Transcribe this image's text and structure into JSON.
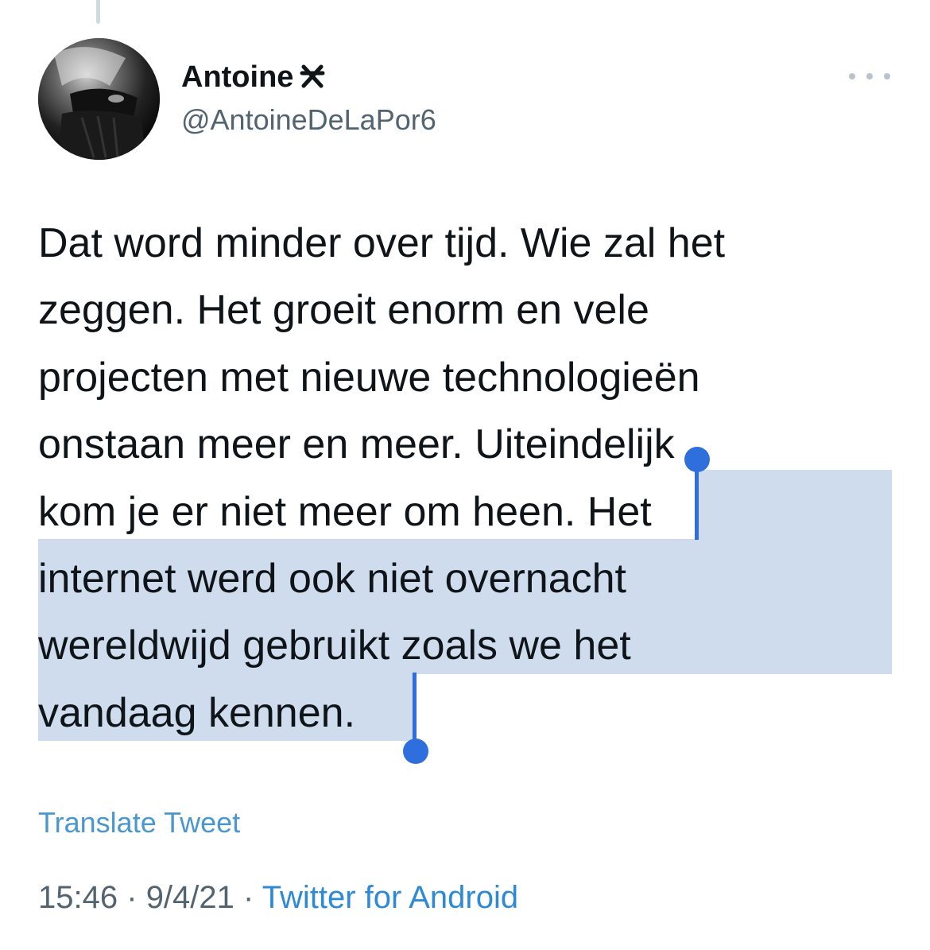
{
  "author": {
    "display_name": "Antoine",
    "badge_glyph": "✘",
    "handle": "@AntoineDeLaPor6"
  },
  "tweet": {
    "lines": [
      {
        "plain": "Dat word minder over tijd. Wie zal het",
        "selected": ""
      },
      {
        "plain": "zeggen. Het groeit enorm en vele",
        "selected": ""
      },
      {
        "plain": "projecten met nieuwe technologieën",
        "selected": ""
      },
      {
        "plain": "onstaan meer en meer. Uiteindelijk",
        "selected": ""
      },
      {
        "plain": "kom je er niet meer om heen. ",
        "selected": "Het"
      },
      {
        "plain": "",
        "selected": "internet werd ook niet overnacht"
      },
      {
        "plain": "",
        "selected": "wereldwijd gebruikt zoals we het"
      },
      {
        "plain": "",
        "selected": "vandaag kennen."
      }
    ]
  },
  "translate_label": "Translate Tweet",
  "meta": {
    "time": "15:46",
    "separator": "·",
    "date": "9/4/21",
    "source": "Twitter for Android"
  },
  "colors": {
    "selection": "#cfdcee",
    "selection_handle": "#2f6fdd",
    "link": "#4a97d0",
    "secondary_text": "#536471"
  }
}
